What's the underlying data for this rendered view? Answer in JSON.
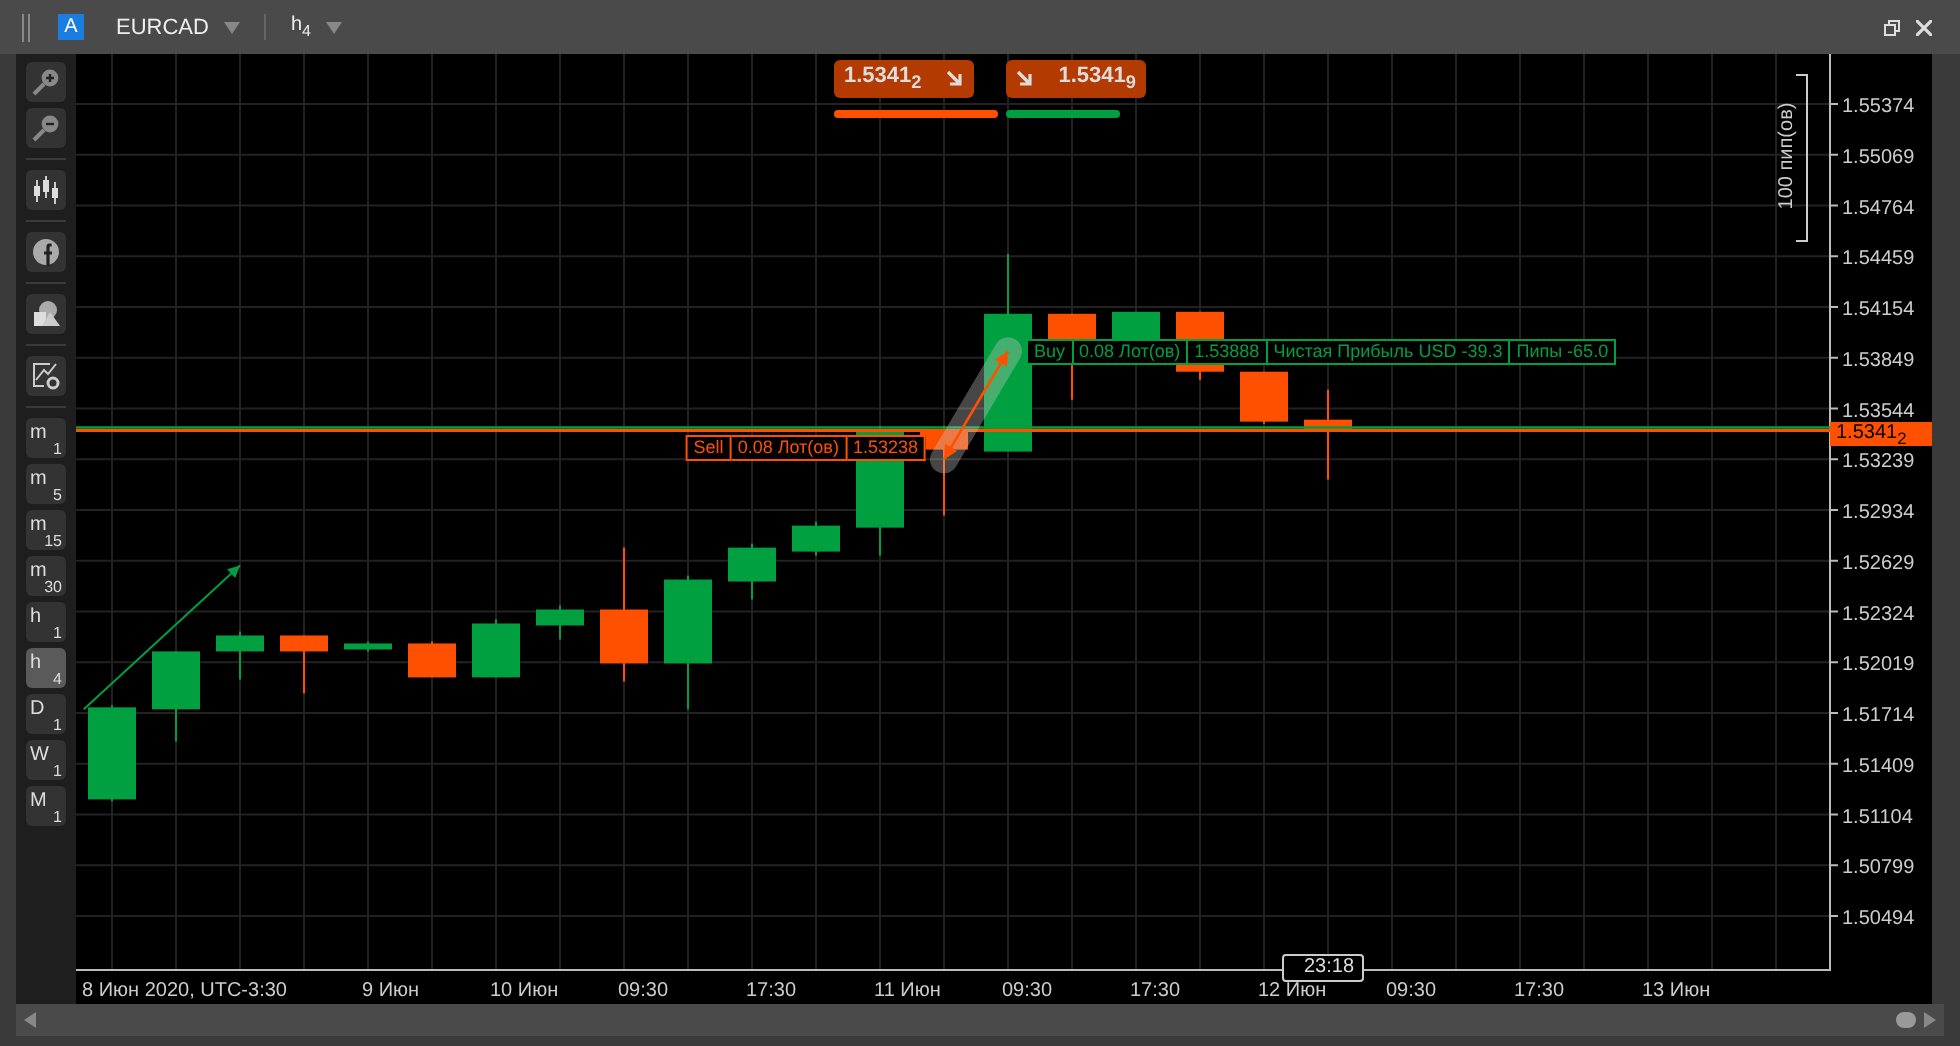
{
  "window": {
    "badge": "A",
    "symbol": "EURCAD",
    "timeframe_letter": "h",
    "timeframe_number": "4"
  },
  "timeframes": [
    {
      "letter": "m",
      "number": "1",
      "selected": false
    },
    {
      "letter": "m",
      "number": "5",
      "selected": false
    },
    {
      "letter": "m",
      "number": "15",
      "selected": false
    },
    {
      "letter": "m",
      "number": "30",
      "selected": false
    },
    {
      "letter": "h",
      "number": "1",
      "selected": false
    },
    {
      "letter": "h",
      "number": "4",
      "selected": true
    },
    {
      "letter": "D",
      "number": "1",
      "selected": false
    },
    {
      "letter": "W",
      "number": "1",
      "selected": false
    },
    {
      "letter": "M",
      "number": "1",
      "selected": false
    }
  ],
  "quotes": {
    "sell": "1.5341$_{2}$",
    "buy": "1.5341$_{9}$"
  },
  "price_axis": {
    "labels": [
      "1.55374",
      "1.55069",
      "1.54764",
      "1.54459",
      "1.54154",
      "1.53849",
      "1.53544",
      "1.53239",
      "1.52934",
      "1.52629",
      "1.52324",
      "1.52019",
      "1.51714",
      "1.51409",
      "1.51104",
      "1.50799",
      "1.50494"
    ],
    "current_price": "1.5341$_{2}$",
    "range_label": "100 пип(ов)"
  },
  "time_axis": {
    "labels": [
      "8 Июн 2020, UTC-3:30",
      "9 Июн",
      "10 Июн",
      "09:30",
      "17:30",
      "11 Июн",
      "09:30",
      "17:30",
      "12 Июн",
      "09:30",
      "17:30",
      "13 Июн"
    ],
    "cursor_time": "23:18"
  },
  "trades": [
    {
      "kind": "sell",
      "cells": [
        "Sell",
        "0.08 Лот(ов)",
        "1.53238"
      ]
    },
    {
      "kind": "buy",
      "cells": [
        "Buy",
        "0.08 Лот(ов)",
        "1.53888",
        "Чистая Прибыль USD -39.3",
        "Пипы -65.0"
      ]
    }
  ]
}
